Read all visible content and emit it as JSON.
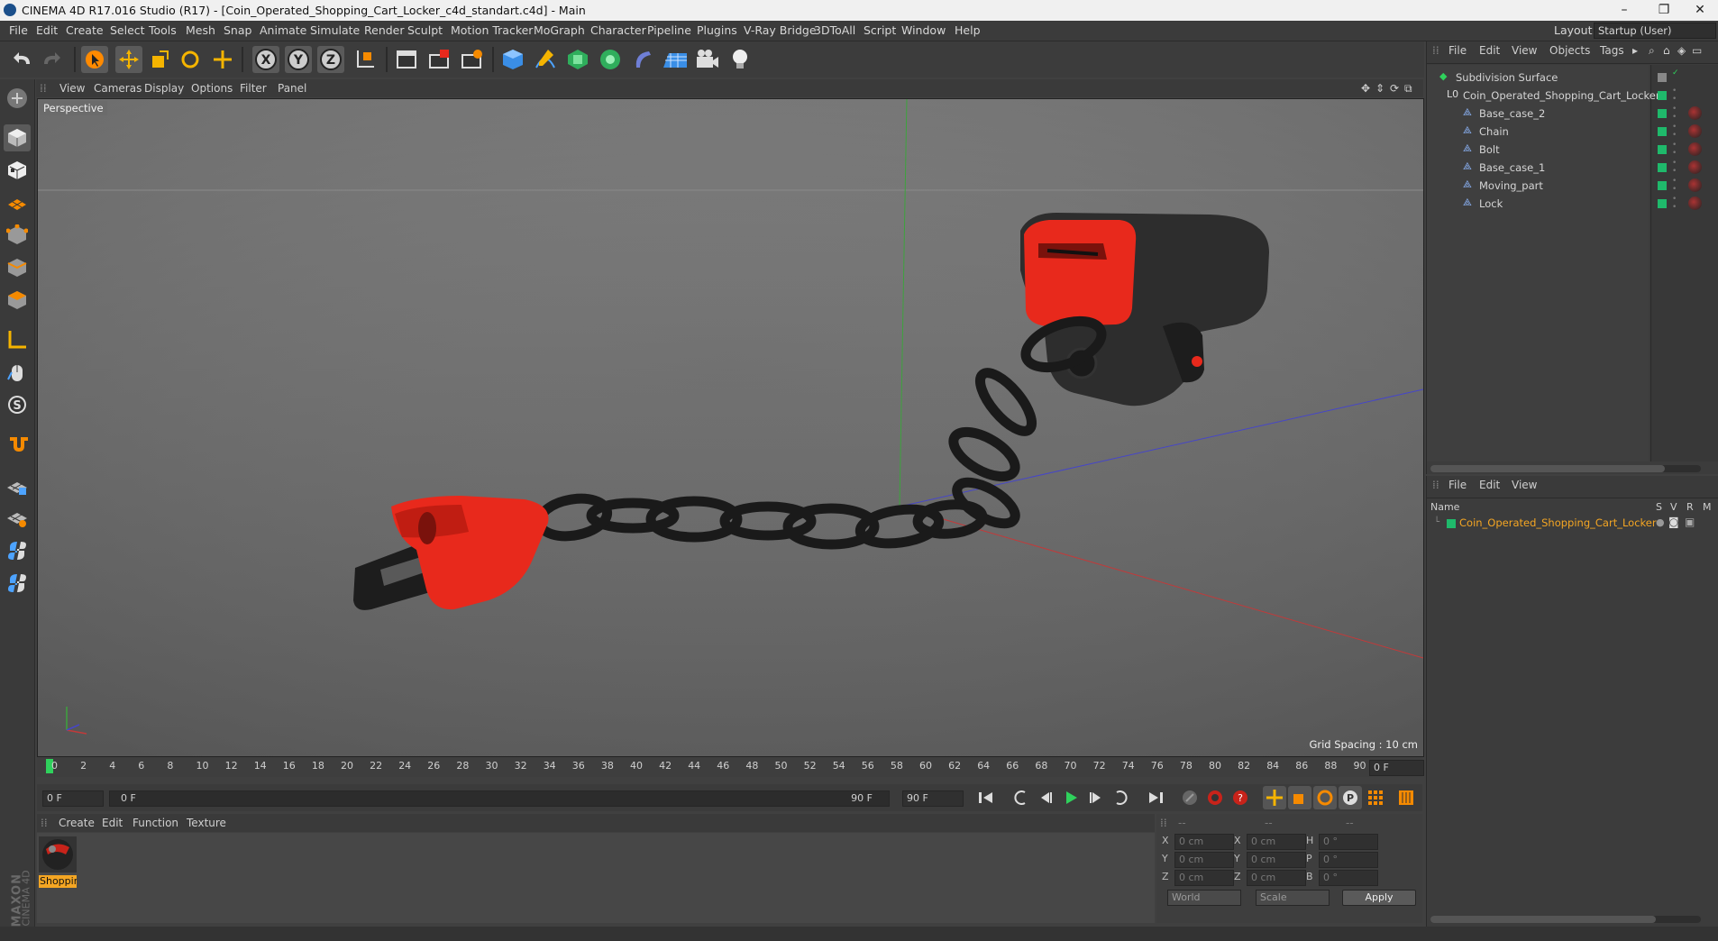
{
  "window": {
    "title": "CINEMA 4D R17.016 Studio (R17) - [Coin_Operated_Shopping_Cart_Locker_c4d_standart.c4d] - Main",
    "minimize": "–",
    "maximize": "❐",
    "close": "✕"
  },
  "menubar": {
    "items": [
      "File",
      "Edit",
      "Create",
      "Select",
      "Tools",
      "Mesh",
      "Snap",
      "Animate",
      "Simulate",
      "Render",
      "Sculpt",
      "Motion Tracker",
      "MoGraph",
      "Character",
      "Pipeline",
      "Plugins",
      "V-Ray Bridge",
      "3DToAll",
      "Script",
      "Window",
      "Help"
    ],
    "layout_label": "Layout:",
    "layout_value": "Startup (User)"
  },
  "viewport": {
    "menu": [
      "View",
      "Cameras",
      "Display",
      "Options",
      "Filter",
      "Panel"
    ],
    "camera_label": "Perspective",
    "grid_spacing": "Grid Spacing : 10 cm"
  },
  "timeline": {
    "ticks": [
      "0",
      "2",
      "4",
      "6",
      "8",
      "10",
      "12",
      "14",
      "16",
      "18",
      "20",
      "22",
      "24",
      "26",
      "28",
      "30",
      "32",
      "34",
      "36",
      "38",
      "40",
      "42",
      "44",
      "46",
      "48",
      "50",
      "52",
      "54",
      "56",
      "58",
      "60",
      "62",
      "64",
      "66",
      "68",
      "70",
      "72",
      "74",
      "76",
      "78",
      "80",
      "82",
      "84",
      "86",
      "88",
      "90"
    ],
    "current_frame": "0 F",
    "start_field": "0 F",
    "range_start": "0 F",
    "range_end": "90 F",
    "end_field": "90 F"
  },
  "material_manager": {
    "menu": [
      "Create",
      "Edit",
      "Function",
      "Texture"
    ],
    "material_name": "Shoppir"
  },
  "coordinates": {
    "header": [
      "--",
      "--",
      "--"
    ],
    "rows": [
      {
        "a_label": "X",
        "a_value": "0 cm",
        "b_label": "X",
        "b_value": "0 cm",
        "c_label": "H",
        "c_value": "0 °"
      },
      {
        "a_label": "Y",
        "a_value": "0 cm",
        "b_label": "Y",
        "b_value": "0 cm",
        "c_label": "P",
        "c_value": "0 °"
      },
      {
        "a_label": "Z",
        "a_value": "0 cm",
        "b_label": "Z",
        "b_value": "0 cm",
        "c_label": "B",
        "c_value": "0 °"
      }
    ],
    "mode_dropdown": "World",
    "scale_dropdown": "Scale",
    "apply_label": "Apply"
  },
  "object_manager": {
    "menu": [
      "File",
      "Edit",
      "View",
      "Objects",
      "Tags"
    ],
    "objects": [
      {
        "name": "Subdivision Surface"
      },
      {
        "name": "Coin_Operated_Shopping_Cart_Locker"
      },
      {
        "name": "Base_case_2"
      },
      {
        "name": "Chain"
      },
      {
        "name": "Bolt"
      },
      {
        "name": "Base_case_1"
      },
      {
        "name": "Moving_part"
      },
      {
        "name": "Lock"
      }
    ]
  },
  "attribute_manager": {
    "menu": [
      "File",
      "Edit",
      "View"
    ],
    "columns": {
      "name": "Name",
      "s": "S",
      "v": "V",
      "r": "R",
      "m": "M"
    },
    "item": "Coin_Operated_Shopping_Cart_Locker"
  },
  "brand": {
    "line1": "MAXON",
    "line2": "CINEMA 4D"
  },
  "colors": {
    "accent_orange": "#f5a623",
    "object_green": "#1fb96b",
    "red_part": "#e8291c"
  }
}
